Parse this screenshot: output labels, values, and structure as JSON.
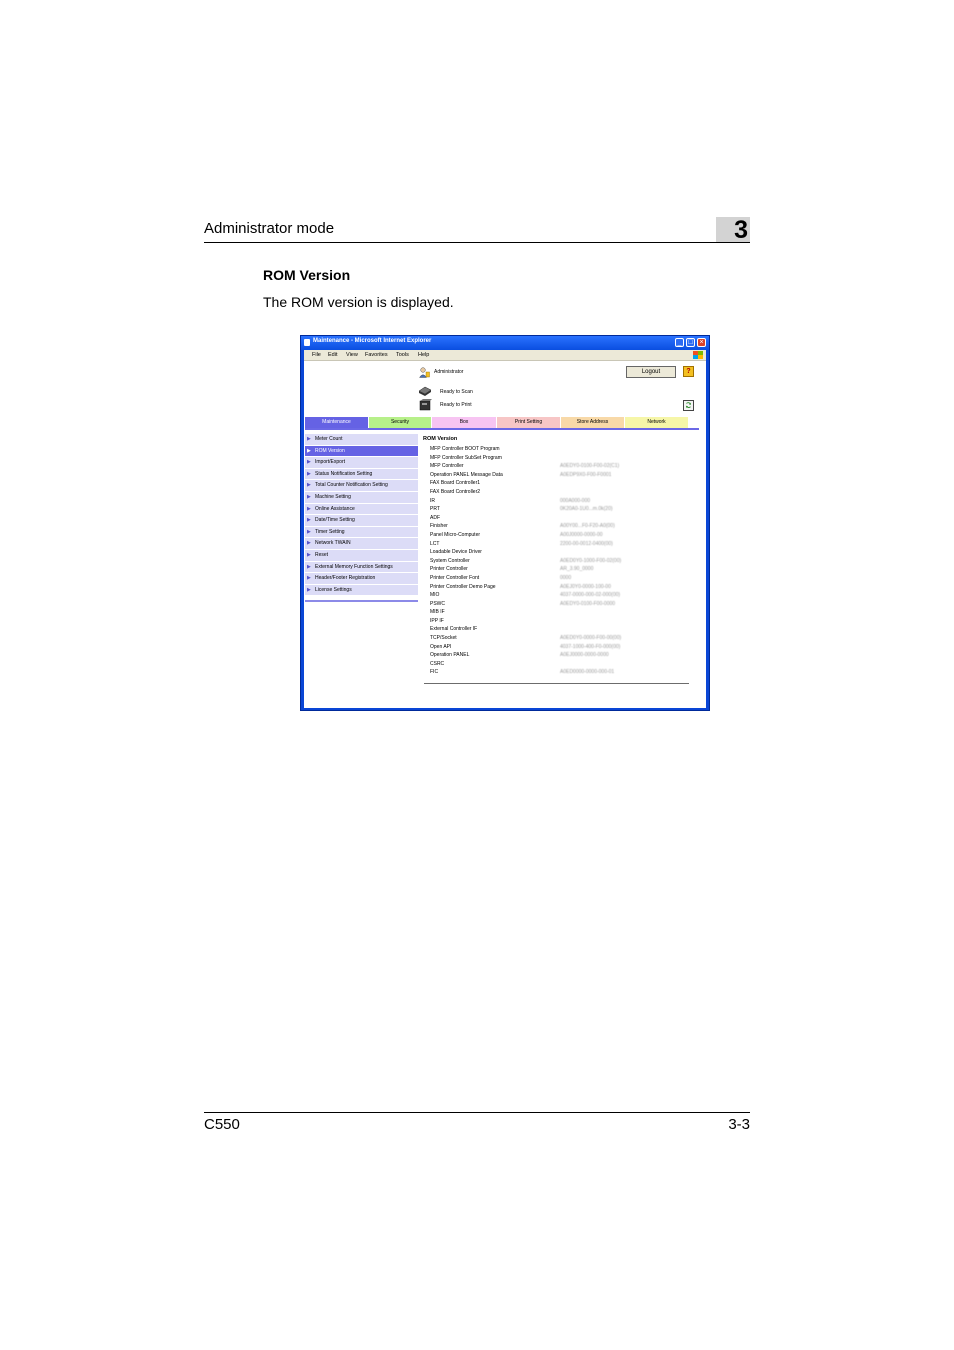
{
  "page_header": {
    "title": "Administrator mode",
    "chapter": "3"
  },
  "section": {
    "title": "ROM Version",
    "body": "The ROM version is displayed."
  },
  "footer": {
    "model": "C550",
    "page": "3-3"
  },
  "window": {
    "title": "Maintenance - Microsoft Internet Explorer",
    "menu": [
      "File",
      "Edit",
      "View",
      "Favorites",
      "Tools",
      "Help"
    ],
    "user": "Administrator",
    "logout_label": "Logout",
    "help_label": "?",
    "status": [
      "Ready to Scan",
      "Ready to Print"
    ],
    "tabs": [
      {
        "label": "Maintenance",
        "color": "#6562e4"
      },
      {
        "label": "Security",
        "color": "#b7f08a"
      },
      {
        "label": "Box",
        "color": "#f7c4f2"
      },
      {
        "label": "Print Setting",
        "color": "#f7c6c6"
      },
      {
        "label": "Store Address",
        "color": "#f8d9a8"
      },
      {
        "label": "Network",
        "color": "#f6f6a8"
      }
    ],
    "sidebar": [
      "Meter Count",
      "ROM Version",
      "Import/Export",
      "Status Notification Setting",
      "Total Counter Notification Setting",
      "Machine Setting",
      "Online Assistance",
      "Date/Time Setting",
      "Timer Setting",
      "Network TWAIN",
      "Reset",
      "External Memory Function Settings",
      "Header/Footer Registration",
      "License Settings"
    ],
    "main_title": "ROM Version",
    "rom_rows": [
      {
        "label": "MFP Controller BOOT Program",
        "value": ""
      },
      {
        "label": "MFP Controller SubSet Program",
        "value": ""
      },
      {
        "label": "MFP Controller",
        "value": "A0EDY0-0100-F00-02(C1)"
      },
      {
        "label": "Operation PANEL Message Data",
        "value": "A0EDP9X0-F00-F0001"
      },
      {
        "label": "FAX Board Controller1",
        "value": ""
      },
      {
        "label": "FAX Board Controller2",
        "value": ""
      },
      {
        "label": "IR",
        "value": "000A000-000"
      },
      {
        "label": "PRT",
        "value": "0K20A0-1U0...m.0k(20)"
      },
      {
        "label": "ADF",
        "value": ""
      },
      {
        "label": "Finisher",
        "value": "A00Y00...F0-F20-A0(00)"
      },
      {
        "label": "Panel Micro-Computer",
        "value": "A00J0000-0000-00"
      },
      {
        "label": "LCT",
        "value": "2200-00-0012-0400(00)"
      },
      {
        "label": "Loadable Device Driver",
        "value": ""
      },
      {
        "label": "System Controller",
        "value": "A0ED0Y0-1000-F00-02(00)"
      },
      {
        "label": "Printer Controller",
        "value": "AR_3.90_0000"
      },
      {
        "label": "Printer Controller Font",
        "value": "0000"
      },
      {
        "label": "Printer Controller Demo Page",
        "value": "A0EJ0Y0-0000-100-00"
      },
      {
        "label": "MIO",
        "value": "4037-0000-000-02-000(00)"
      },
      {
        "label": "PSWC",
        "value": "A0EDY0-0100-F00-0000"
      },
      {
        "label": "MIB IF",
        "value": ""
      },
      {
        "label": "IPP IF",
        "value": ""
      },
      {
        "label": "External Controller IF",
        "value": ""
      },
      {
        "label": "TCP/Socket",
        "value": "A0ED0Y0-0000-F00-00(00)"
      },
      {
        "label": "Open API",
        "value": "4037-1000-400-F0-000(00)"
      },
      {
        "label": "Operation PANEL",
        "value": "A0EJ0000-0000-0000"
      },
      {
        "label": "CSRC",
        "value": ""
      },
      {
        "label": "FIC",
        "value": "A0ED0000-0000-000-01"
      }
    ]
  }
}
